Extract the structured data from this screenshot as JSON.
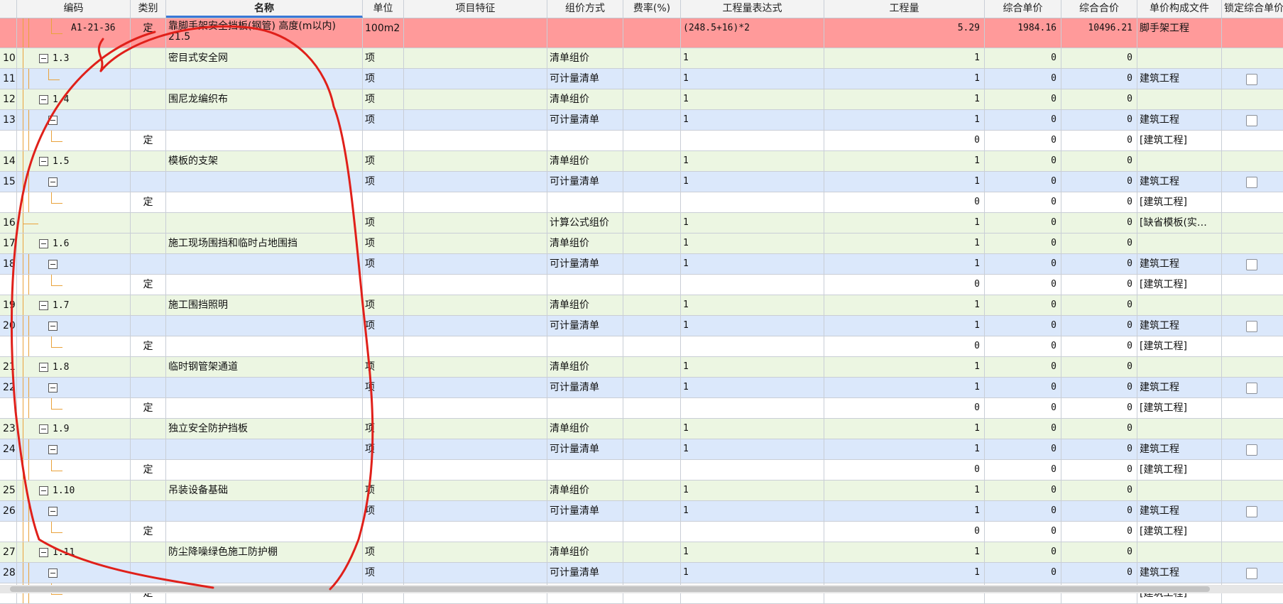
{
  "columns": {
    "code": "编码",
    "category": "类别",
    "name": "名称",
    "unit": "单位",
    "feature": "项目特征",
    "method": "组价方式",
    "rate": "费率(%)",
    "expr": "工程量表达式",
    "qty": "工程量",
    "unit_price": "综合单价",
    "total": "综合合价",
    "file": "单价构成文件",
    "lock": "锁定综合单价"
  },
  "rows": [
    {
      "rn": "",
      "code": "A1-21-36",
      "level": 3,
      "expander": false,
      "category": "定",
      "name_line1": "靠脚手架安全挡板(钢管) 高度(m以内)",
      "name_line2": "21.5",
      "unit": "100m2",
      "feature": "",
      "method": "",
      "rate": "",
      "expr": "(248.5+16)*2",
      "qty": "5.29",
      "unit_price": "1984.16",
      "total": "10496.21",
      "file": "脚手架工程",
      "lock": false,
      "style": "sel"
    },
    {
      "rn": "10",
      "code": "1.3",
      "level": 1,
      "expander": true,
      "category": "",
      "name": "密目式安全网",
      "unit": "项",
      "feature": "",
      "method": "清单组价",
      "rate": "",
      "expr": "1",
      "qty": "1",
      "unit_price": "0",
      "total": "0",
      "file": "",
      "lock": false,
      "style": "green"
    },
    {
      "rn": "11",
      "code": "",
      "level": 2,
      "expander": false,
      "category": "",
      "name": "",
      "unit": "项",
      "feature": "",
      "method": "可计量清单",
      "rate": "",
      "expr": "1",
      "qty": "1",
      "unit_price": "0",
      "total": "0",
      "file": "建筑工程",
      "lock": true,
      "style": "blue"
    },
    {
      "rn": "12",
      "code": "1.4",
      "level": 1,
      "expander": true,
      "category": "",
      "name": "围尼龙编织布",
      "unit": "项",
      "feature": "",
      "method": "清单组价",
      "rate": "",
      "expr": "1",
      "qty": "1",
      "unit_price": "0",
      "total": "0",
      "file": "",
      "lock": false,
      "style": "green"
    },
    {
      "rn": "13",
      "code": "",
      "level": 2,
      "expander": true,
      "category": "",
      "name": "",
      "unit": "项",
      "feature": "",
      "method": "可计量清单",
      "rate": "",
      "expr": "1",
      "qty": "1",
      "unit_price": "0",
      "total": "0",
      "file": "建筑工程",
      "lock": true,
      "style": "blue"
    },
    {
      "rn": "",
      "code": "",
      "level": 3,
      "expander": false,
      "category": "定",
      "name": "",
      "unit": "",
      "feature": "",
      "method": "",
      "rate": "",
      "expr": "",
      "qty": "0",
      "unit_price": "0",
      "total": "0",
      "file": "[建筑工程]",
      "lock": false,
      "style": "white"
    },
    {
      "rn": "14",
      "code": "1.5",
      "level": 1,
      "expander": true,
      "category": "",
      "name": "模板的支架",
      "unit": "项",
      "feature": "",
      "method": "清单组价",
      "rate": "",
      "expr": "1",
      "qty": "1",
      "unit_price": "0",
      "total": "0",
      "file": "",
      "lock": false,
      "style": "green"
    },
    {
      "rn": "15",
      "code": "",
      "level": 2,
      "expander": true,
      "category": "",
      "name": "",
      "unit": "项",
      "feature": "",
      "method": "可计量清单",
      "rate": "",
      "expr": "1",
      "qty": "1",
      "unit_price": "0",
      "total": "0",
      "file": "建筑工程",
      "lock": true,
      "style": "blue"
    },
    {
      "rn": "",
      "code": "",
      "level": 3,
      "expander": false,
      "category": "定",
      "name": "",
      "unit": "",
      "feature": "",
      "method": "",
      "rate": "",
      "expr": "",
      "qty": "0",
      "unit_price": "0",
      "total": "0",
      "file": "[建筑工程]",
      "lock": false,
      "style": "white"
    },
    {
      "rn": "16",
      "code": "",
      "level": 1,
      "expander": false,
      "category": "",
      "name": "",
      "unit": "项",
      "feature": "",
      "method": "计算公式组价",
      "rate": "",
      "expr": "1",
      "qty": "1",
      "unit_price": "0",
      "total": "0",
      "file": "[缺省模板(实…",
      "lock": false,
      "style": "green"
    },
    {
      "rn": "17",
      "code": "1.6",
      "level": 1,
      "expander": true,
      "category": "",
      "name": "施工现场围挡和临时占地围挡",
      "unit": "项",
      "feature": "",
      "method": "清单组价",
      "rate": "",
      "expr": "1",
      "qty": "1",
      "unit_price": "0",
      "total": "0",
      "file": "",
      "lock": false,
      "style": "green"
    },
    {
      "rn": "18",
      "code": "",
      "level": 2,
      "expander": true,
      "category": "",
      "name": "",
      "unit": "项",
      "feature": "",
      "method": "可计量清单",
      "rate": "",
      "expr": "1",
      "qty": "1",
      "unit_price": "0",
      "total": "0",
      "file": "建筑工程",
      "lock": true,
      "style": "blue"
    },
    {
      "rn": "",
      "code": "",
      "level": 3,
      "expander": false,
      "category": "定",
      "name": "",
      "unit": "",
      "feature": "",
      "method": "",
      "rate": "",
      "expr": "",
      "qty": "0",
      "unit_price": "0",
      "total": "0",
      "file": "[建筑工程]",
      "lock": false,
      "style": "white"
    },
    {
      "rn": "19",
      "code": "1.7",
      "level": 1,
      "expander": true,
      "category": "",
      "name": "施工围挡照明",
      "unit": "项",
      "feature": "",
      "method": "清单组价",
      "rate": "",
      "expr": "1",
      "qty": "1",
      "unit_price": "0",
      "total": "0",
      "file": "",
      "lock": false,
      "style": "green"
    },
    {
      "rn": "20",
      "code": "",
      "level": 2,
      "expander": true,
      "category": "",
      "name": "",
      "unit": "项",
      "feature": "",
      "method": "可计量清单",
      "rate": "",
      "expr": "1",
      "qty": "1",
      "unit_price": "0",
      "total": "0",
      "file": "建筑工程",
      "lock": true,
      "style": "blue"
    },
    {
      "rn": "",
      "code": "",
      "level": 3,
      "expander": false,
      "category": "定",
      "name": "",
      "unit": "",
      "feature": "",
      "method": "",
      "rate": "",
      "expr": "",
      "qty": "0",
      "unit_price": "0",
      "total": "0",
      "file": "[建筑工程]",
      "lock": false,
      "style": "white"
    },
    {
      "rn": "21",
      "code": "1.8",
      "level": 1,
      "expander": true,
      "category": "",
      "name": "临时钢管架通道",
      "unit": "项",
      "feature": "",
      "method": "清单组价",
      "rate": "",
      "expr": "1",
      "qty": "1",
      "unit_price": "0",
      "total": "0",
      "file": "",
      "lock": false,
      "style": "green"
    },
    {
      "rn": "22",
      "code": "",
      "level": 2,
      "expander": true,
      "category": "",
      "name": "",
      "unit": "项",
      "feature": "",
      "method": "可计量清单",
      "rate": "",
      "expr": "1",
      "qty": "1",
      "unit_price": "0",
      "total": "0",
      "file": "建筑工程",
      "lock": true,
      "style": "blue"
    },
    {
      "rn": "",
      "code": "",
      "level": 3,
      "expander": false,
      "category": "定",
      "name": "",
      "unit": "",
      "feature": "",
      "method": "",
      "rate": "",
      "expr": "",
      "qty": "0",
      "unit_price": "0",
      "total": "0",
      "file": "[建筑工程]",
      "lock": false,
      "style": "white"
    },
    {
      "rn": "23",
      "code": "1.9",
      "level": 1,
      "expander": true,
      "category": "",
      "name": "独立安全防护挡板",
      "unit": "项",
      "feature": "",
      "method": "清单组价",
      "rate": "",
      "expr": "1",
      "qty": "1",
      "unit_price": "0",
      "total": "0",
      "file": "",
      "lock": false,
      "style": "green"
    },
    {
      "rn": "24",
      "code": "",
      "level": 2,
      "expander": true,
      "category": "",
      "name": "",
      "unit": "项",
      "feature": "",
      "method": "可计量清单",
      "rate": "",
      "expr": "1",
      "qty": "1",
      "unit_price": "0",
      "total": "0",
      "file": "建筑工程",
      "lock": true,
      "style": "blue"
    },
    {
      "rn": "",
      "code": "",
      "level": 3,
      "expander": false,
      "category": "定",
      "name": "",
      "unit": "",
      "feature": "",
      "method": "",
      "rate": "",
      "expr": "",
      "qty": "0",
      "unit_price": "0",
      "total": "0",
      "file": "[建筑工程]",
      "lock": false,
      "style": "white"
    },
    {
      "rn": "25",
      "code": "1.10",
      "level": 1,
      "expander": true,
      "category": "",
      "name": "吊装设备基础",
      "unit": "项",
      "feature": "",
      "method": "清单组价",
      "rate": "",
      "expr": "1",
      "qty": "1",
      "unit_price": "0",
      "total": "0",
      "file": "",
      "lock": false,
      "style": "green"
    },
    {
      "rn": "26",
      "code": "",
      "level": 2,
      "expander": true,
      "category": "",
      "name": "",
      "unit": "项",
      "feature": "",
      "method": "可计量清单",
      "rate": "",
      "expr": "1",
      "qty": "1",
      "unit_price": "0",
      "total": "0",
      "file": "建筑工程",
      "lock": true,
      "style": "blue"
    },
    {
      "rn": "",
      "code": "",
      "level": 3,
      "expander": false,
      "category": "定",
      "name": "",
      "unit": "",
      "feature": "",
      "method": "",
      "rate": "",
      "expr": "",
      "qty": "0",
      "unit_price": "0",
      "total": "0",
      "file": "[建筑工程]",
      "lock": false,
      "style": "white"
    },
    {
      "rn": "27",
      "code": "1.11",
      "level": 1,
      "expander": true,
      "category": "",
      "name": "防尘降噪绿色施工防护棚",
      "unit": "项",
      "feature": "",
      "method": "清单组价",
      "rate": "",
      "expr": "1",
      "qty": "1",
      "unit_price": "0",
      "total": "0",
      "file": "",
      "lock": false,
      "style": "green"
    },
    {
      "rn": "28",
      "code": "",
      "level": 2,
      "expander": true,
      "category": "",
      "name": "",
      "unit": "项",
      "feature": "",
      "method": "可计量清单",
      "rate": "",
      "expr": "1",
      "qty": "1",
      "unit_price": "0",
      "total": "0",
      "file": "建筑工程",
      "lock": true,
      "style": "blue"
    },
    {
      "rn": "",
      "code": "",
      "level": 3,
      "expander": false,
      "category": "定",
      "name": "",
      "unit": "",
      "feature": "",
      "method": "",
      "rate": "",
      "expr": "",
      "qty": "",
      "unit_price": "",
      "total": "",
      "file": "[建筑工程]",
      "lock": false,
      "style": "white"
    }
  ],
  "colors": {
    "selected_row": "#ff9a9a",
    "list_row": "#ecf6e2",
    "sub_row": "#dbe8fb",
    "tree_guide": "#e9a23b",
    "annotation": "#e0201a"
  }
}
